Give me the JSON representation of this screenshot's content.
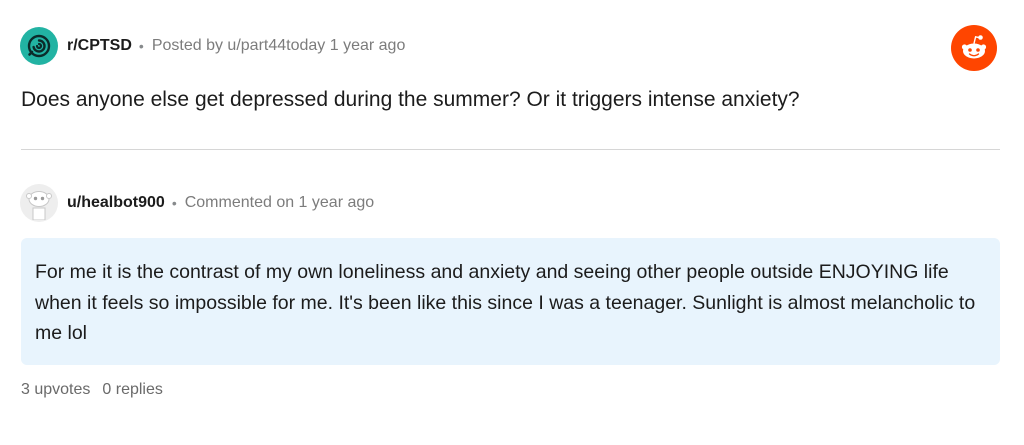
{
  "post": {
    "subreddit": "r/CPTSD",
    "separator": "•",
    "posted_by_prefix": "Posted by",
    "author": "u/part44today",
    "age": "1 year ago",
    "title": "Does anyone else get depressed during the summer? Or it triggers intense anxiety?",
    "subreddit_icon": "cptsd-community-icon",
    "brand_icon": "reddit-snoo-icon"
  },
  "comment": {
    "author": "u/healbot900",
    "separator": "•",
    "meta": "Commented on 1 year ago",
    "avatar_icon": "default-snoo-avatar-icon",
    "body": "For me it is the contrast of my own loneliness and anxiety and seeing other people outside ENJOYING life when it feels so impossible for me. It's been like this since I was a teenager. Sunlight is almost melancholic to me lol",
    "upvotes": "3 upvotes",
    "replies": "0 replies"
  },
  "colors": {
    "subreddit_icon_bg": "#22b3a3",
    "reddit_orange": "#ff4500",
    "comment_bg": "#e8f4fd",
    "meta_gray": "#7c7c7c",
    "divider": "#d6d6d6"
  }
}
